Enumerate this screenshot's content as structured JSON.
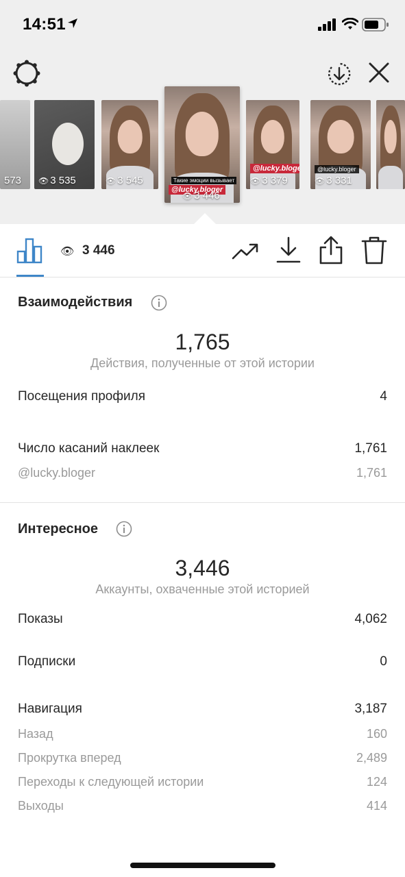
{
  "status_bar": {
    "time": "14:51"
  },
  "stories": [
    {
      "views": "573",
      "kind": "screen",
      "tag": ""
    },
    {
      "views": "3 535",
      "kind": "cat",
      "tag": ""
    },
    {
      "views": "3 545",
      "kind": "girl",
      "tag": ""
    },
    {
      "views": "3 446",
      "kind": "girl",
      "tag": "@lucky.bloger",
      "title": "Такие эмоции вызывает",
      "selected": true
    },
    {
      "views": "3 379",
      "kind": "girl",
      "tag": "@lucky.bloger"
    },
    {
      "views": "3 331",
      "kind": "girl",
      "tag": "@lucky.bloger"
    },
    {
      "views": "",
      "kind": "girl",
      "tag": ""
    }
  ],
  "toolbar": {
    "view_count": "3 446"
  },
  "interactions": {
    "title": "Взаимодействия",
    "total": "1,765",
    "total_caption": "Действия, полученные от этой истории",
    "profile_visits_label": "Посещения профиля",
    "profile_visits_value": "4",
    "sticker_taps_label": "Число касаний наклеек",
    "sticker_taps_value": "1,761",
    "sticker_handle_label": "@lucky.bloger",
    "sticker_handle_value": "1,761"
  },
  "discovery": {
    "title": "Интересное",
    "total": "3,446",
    "total_caption": "Аккаунты, охваченные этой историей",
    "impressions_label": "Показы",
    "impressions_value": "4,062",
    "follows_label": "Подписки",
    "follows_value": "0",
    "navigation_label": "Навигация",
    "navigation_value": "3,187",
    "back_label": "Назад",
    "back_value": "160",
    "forward_label": "Прокрутка вперед",
    "forward_value": "2,489",
    "next_story_label": "Переходы к следующей истории",
    "next_story_value": "124",
    "exits_label": "Выходы",
    "exits_value": "414"
  },
  "colors": {
    "accent": "#3e86c8",
    "muted": "#9a9a9a",
    "header_bg": "#efefef"
  }
}
